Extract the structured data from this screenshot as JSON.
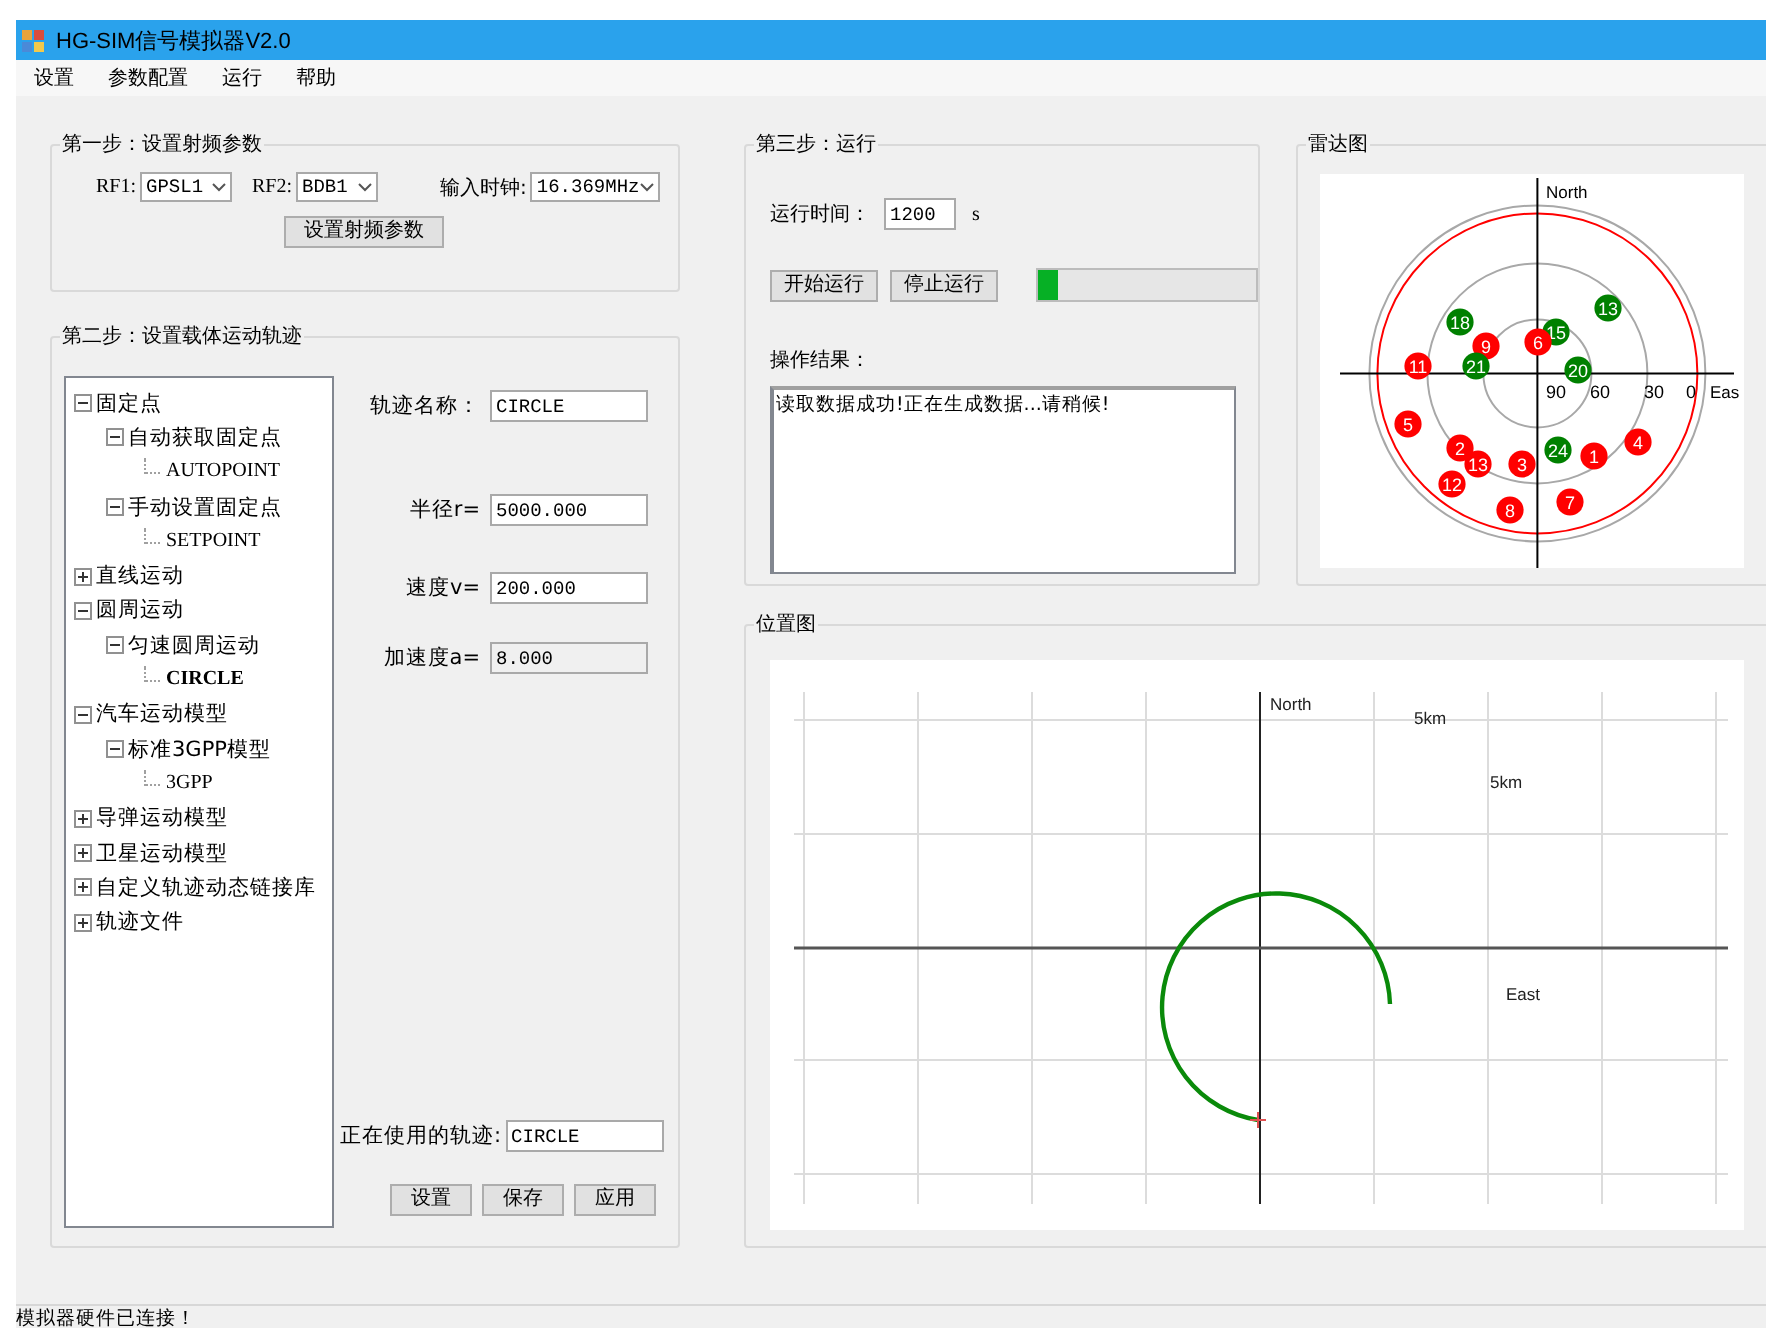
{
  "window": {
    "title": "HG-SIM信号模拟器V2.0"
  },
  "menu": [
    "设置",
    "参数配置",
    "运行",
    "帮助"
  ],
  "step1": {
    "title": "第一步：设置射频参数",
    "fields": [
      {
        "label": "RF1:",
        "value": "GPSL1"
      },
      {
        "label": "RF2:",
        "value": "BDB1"
      },
      {
        "label": "输入时钟:",
        "value": "16.369MHz"
      }
    ],
    "button": "设置射频参数"
  },
  "step2": {
    "title": "第二步：设置载体运动轨迹",
    "tree": [
      {
        "label": "固定点",
        "expanded": true,
        "selected": false,
        "children": [
          {
            "label": "自动获取固定点",
            "expanded": true,
            "selected": false,
            "children": [
              {
                "label": "AUTOPOINT",
                "selected": false
              }
            ]
          },
          {
            "label": "手动设置固定点",
            "expanded": true,
            "selected": false,
            "children": [
              {
                "label": "SETPOINT",
                "selected": false
              }
            ]
          }
        ]
      },
      {
        "label": "直线运动",
        "expanded": false,
        "selected": false
      },
      {
        "label": "圆周运动",
        "expanded": true,
        "selected": false,
        "children": [
          {
            "label": "匀速圆周运动",
            "expanded": true,
            "selected": false,
            "children": [
              {
                "label": "CIRCLE",
                "selected": true
              }
            ]
          }
        ]
      },
      {
        "label": "汽车运动模型",
        "expanded": true,
        "selected": false,
        "children": [
          {
            "label": "标准3GPP模型",
            "expanded": true,
            "selected": false,
            "children": [
              {
                "label": "3GPP",
                "selected": false
              }
            ]
          }
        ]
      },
      {
        "label": "导弹运动模型",
        "expanded": false,
        "selected": false
      },
      {
        "label": "卫星运动模型",
        "expanded": false,
        "selected": false
      },
      {
        "label": "自定义轨迹动态链接库",
        "expanded": false,
        "selected": false
      },
      {
        "label": "轨迹文件",
        "expanded": false,
        "selected": false
      }
    ],
    "fields": [
      {
        "label": "轨迹名称：",
        "value": "CIRCLE",
        "disabled": false
      },
      {
        "label": "半径r=",
        "value": "5000.000",
        "disabled": false
      },
      {
        "label": "速度v=",
        "value": "200.000",
        "disabled": false
      },
      {
        "label": "加速度a=",
        "value": "8.000",
        "disabled": true
      }
    ],
    "current": {
      "label": "正在使用的轨迹:",
      "value": "CIRCLE"
    },
    "buttons": [
      "设置",
      "保存",
      "应用"
    ]
  },
  "step3": {
    "title": "第三步：运行",
    "time": {
      "label": "运行时间：",
      "value": "1200",
      "unit": "s"
    },
    "buttons": [
      "开始运行",
      "停止运行"
    ],
    "progress": {
      "level": 0.09
    },
    "result": {
      "label": "操作结果：",
      "value": "读取数据成功!正在生成数据...请稍候!"
    }
  },
  "radar": {
    "title": "雷达图",
    "north": "North",
    "east": "Eas",
    "rings": [
      "90",
      "60",
      "30",
      "0"
    ],
    "satellites": [
      {
        "label": "18",
        "color": "#008000"
      },
      {
        "label": "15",
        "color": "#008000"
      },
      {
        "label": "13",
        "color": "#008000"
      },
      {
        "label": "9",
        "color": "#ff0000"
      },
      {
        "label": "6",
        "color": "#ff0000"
      },
      {
        "label": "11",
        "color": "#ff0000"
      },
      {
        "label": "21",
        "color": "#008000"
      },
      {
        "label": "20",
        "color": "#008000"
      },
      {
        "label": "5",
        "color": "#ff0000"
      },
      {
        "label": "4",
        "color": "#ff0000"
      },
      {
        "label": "2",
        "color": "#ff0000"
      },
      {
        "label": "13",
        "color": "#ff0000"
      },
      {
        "label": "3",
        "color": "#ff0000"
      },
      {
        "label": "24",
        "color": "#008000"
      },
      {
        "label": "1",
        "color": "#ff0000"
      },
      {
        "label": "12",
        "color": "#ff0000"
      },
      {
        "label": "8",
        "color": "#ff0000"
      },
      {
        "label": "7",
        "color": "#ff0000"
      }
    ]
  },
  "position": {
    "title": "位置图",
    "north": "North",
    "east": "East",
    "scales": [
      "5km",
      "5km"
    ]
  },
  "status_bar": "模拟器硬件已连接！"
}
